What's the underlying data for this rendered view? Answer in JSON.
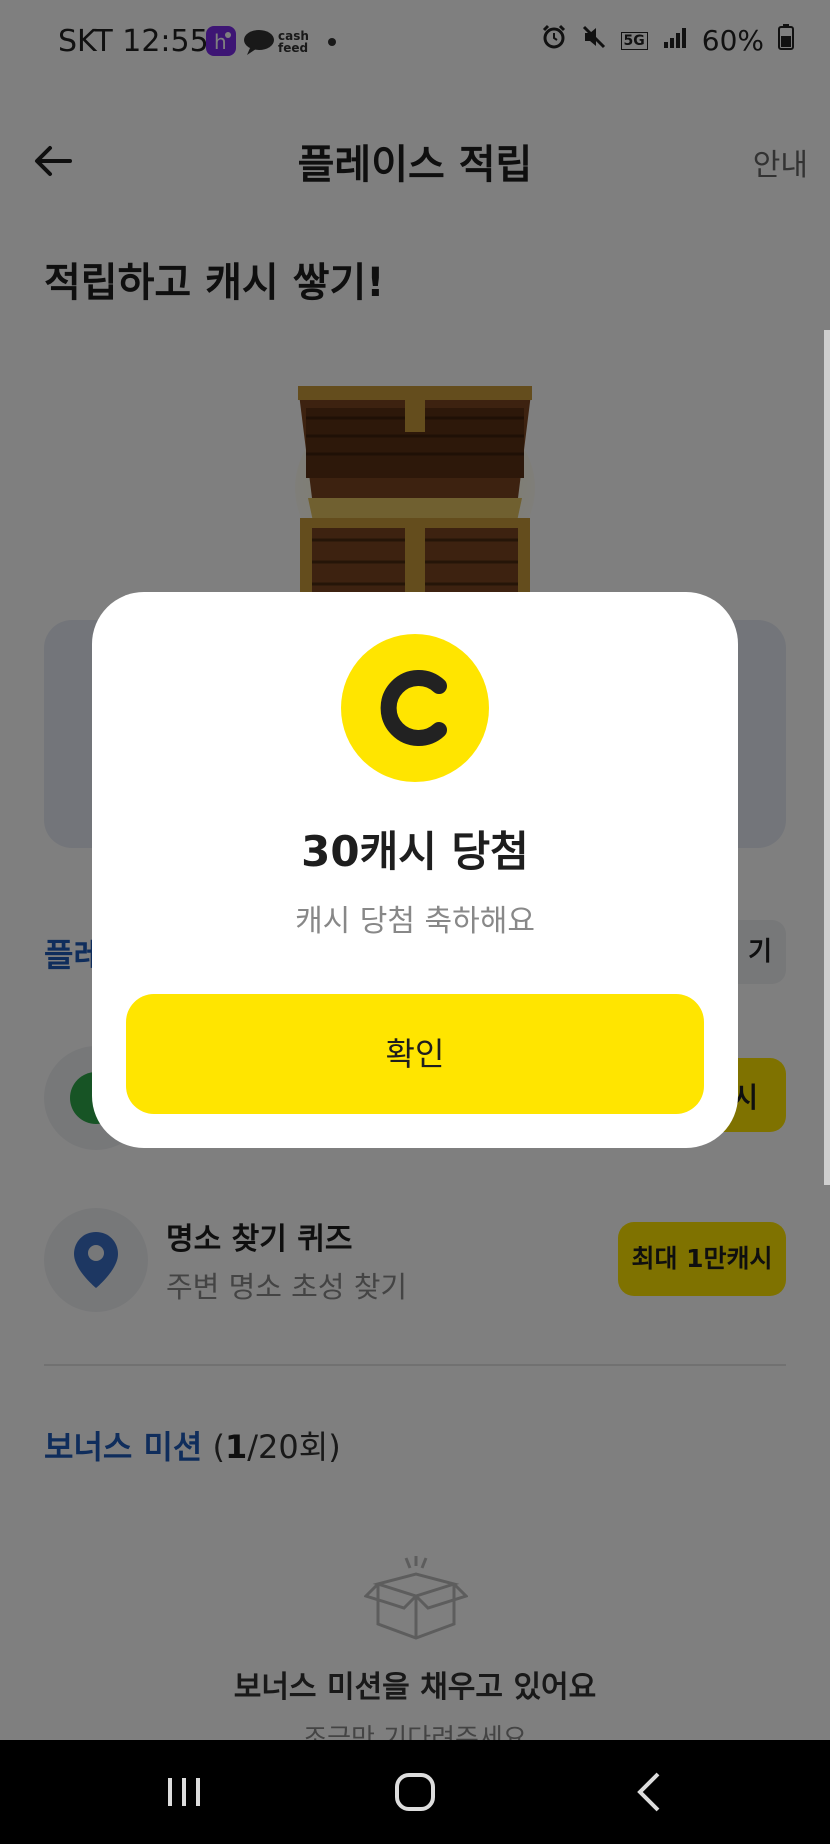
{
  "status_bar": {
    "carrier_time": "SKT 12:55",
    "battery": "60%",
    "network": "5G",
    "app_icons": [
      "h-app-icon",
      "cashfeed-icon"
    ],
    "cashfeed_label": "cash feed"
  },
  "header": {
    "title": "플레이스 적립",
    "guide_label": "안내"
  },
  "hero": {
    "title": "적립하고 캐시 쌓기!"
  },
  "place_section": {
    "title_partial": "플레",
    "button_partial": "기"
  },
  "mission_row1": {
    "button_partial": "시"
  },
  "mission_row2": {
    "title": "명소 찾기 퀴즈",
    "subtitle": "주변 명소 초성 찾기",
    "reward": "최대 1만캐시"
  },
  "bonus": {
    "title": "보너스 미션",
    "count_open": " (",
    "count_current": "1",
    "count_total": "/20회)",
    "empty_title": "보너스 미션을 채우고 있어요",
    "empty_sub": "조금만 기다려주세요"
  },
  "modal": {
    "coin_letter": "C",
    "title": "30캐시 당첨",
    "subtitle": "캐시 당첨 축하해요",
    "confirm_label": "확인"
  },
  "colors": {
    "accent_yellow": "#ffe500",
    "section_blue": "#1f5ab8",
    "pin_blue": "#3a6fc4"
  }
}
